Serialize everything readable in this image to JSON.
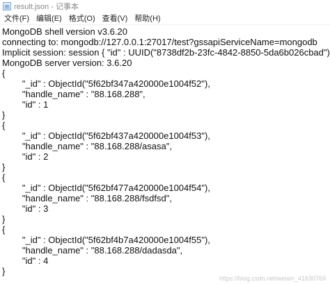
{
  "window": {
    "title": "result.json - 记事本",
    "icon": "notepad-icon"
  },
  "menu": [
    "文件(F)",
    "编辑(E)",
    "格式(O)",
    "查看(V)",
    "帮助(H)"
  ],
  "lines": [
    "MongoDB shell version v3.6.20",
    "connecting to: mongodb://127.0.0.1:27017/test?gssapiServiceName=mongodb",
    "Implicit session: session { \"id\" : UUID(\"8738df2b-23fc-4842-8850-5da6b026cbad\") }",
    "MongoDB server version: 3.6.20",
    "{",
    "",
    "        \"_id\" : ObjectId(\"5f62bf347a420000e1004f52\"),",
    "        \"handle_name\" : \"88.168.288\",",
    "        \"id\" : 1",
    "}",
    "{",
    "        \"_id\" : ObjectId(\"5f62bf437a420000e1004f53\"),",
    "        \"handle_name\" : \"88.168.288/asasa\",",
    "        \"id\" : 2",
    "}",
    "{",
    "",
    "        \"_id\" : ObjectId(\"5f62bf477a420000e1004f54\"),",
    "        \"handle_name\" : \"88.168.288/fsdfsd\",",
    "        \"id\" : 3",
    "}",
    "{",
    "",
    "        \"_id\" : ObjectId(\"5f62bf4b7a420000e1004f55\"),",
    "        \"handle_name\" : \"88.168.288/dadasda\",",
    "        \"id\" : 4",
    "}"
  ],
  "watermark": "https://blog.csdn.net/weixin_41630769"
}
